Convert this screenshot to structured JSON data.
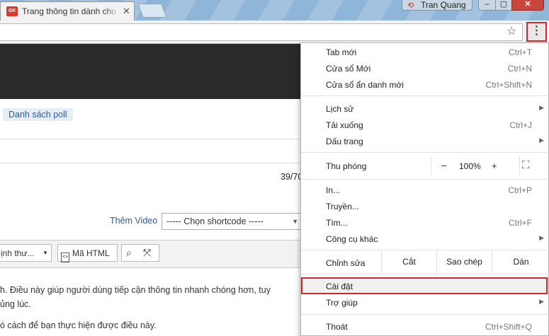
{
  "browser": {
    "tab_title": "Trang thông tin dành cho",
    "tab_favicon": "GK",
    "tab_close": "✕",
    "profile_name": "Tran Quang",
    "window_controls": {
      "minimize": "–",
      "maximize": "▢",
      "close": "✕"
    },
    "star_icon": "☆",
    "menu_icon": "⋮"
  },
  "page": {
    "poll_link": "Danh sách poll",
    "counter": "39/70",
    "video_link": "Thêm Video",
    "shortcode_select": "----- Chọn shortcode -----",
    "format_select": "ịnh thư...",
    "html_button": "Mã HTML",
    "paragraph1_line1": "h. Điều này giúp người dùng tiếp cận thông tin nhanh chóng hơn, tuy",
    "paragraph1_line2": "ủng lúc.",
    "paragraph2": "ó cách để bạn thực hiện được điều này."
  },
  "menu": {
    "new_tab": {
      "label": "Tab mới",
      "shortcut": "Ctrl+T"
    },
    "new_window": {
      "label": "Cửa sổ Mới",
      "shortcut": "Ctrl+N"
    },
    "incognito": {
      "label": "Cửa sổ ẩn danh mới",
      "shortcut": "Ctrl+Shift+N"
    },
    "history": {
      "label": "Lịch sử"
    },
    "downloads": {
      "label": "Tải xuống",
      "shortcut": "Ctrl+J"
    },
    "bookmarks": {
      "label": "Dấu trang"
    },
    "zoom": {
      "label": "Thu phóng",
      "minus": "–",
      "value": "100%",
      "plus": "+"
    },
    "print": {
      "label": "In...",
      "shortcut": "Ctrl+P"
    },
    "cast": {
      "label": "Truyền..."
    },
    "find": {
      "label": "Tìm...",
      "shortcut": "Ctrl+F"
    },
    "more_tools": {
      "label": "Công cụ khác"
    },
    "edit": {
      "label": "Chỉnh sửa",
      "cut": "Cắt",
      "copy": "Sao chép",
      "paste": "Dán"
    },
    "settings": {
      "label": "Cài đặt"
    },
    "help": {
      "label": "Trợ giúp"
    },
    "exit": {
      "label": "Thoát",
      "shortcut": "Ctrl+Shift+Q"
    }
  },
  "colors": {
    "highlight_border": "#d3272c",
    "link": "#2a5d9f"
  }
}
